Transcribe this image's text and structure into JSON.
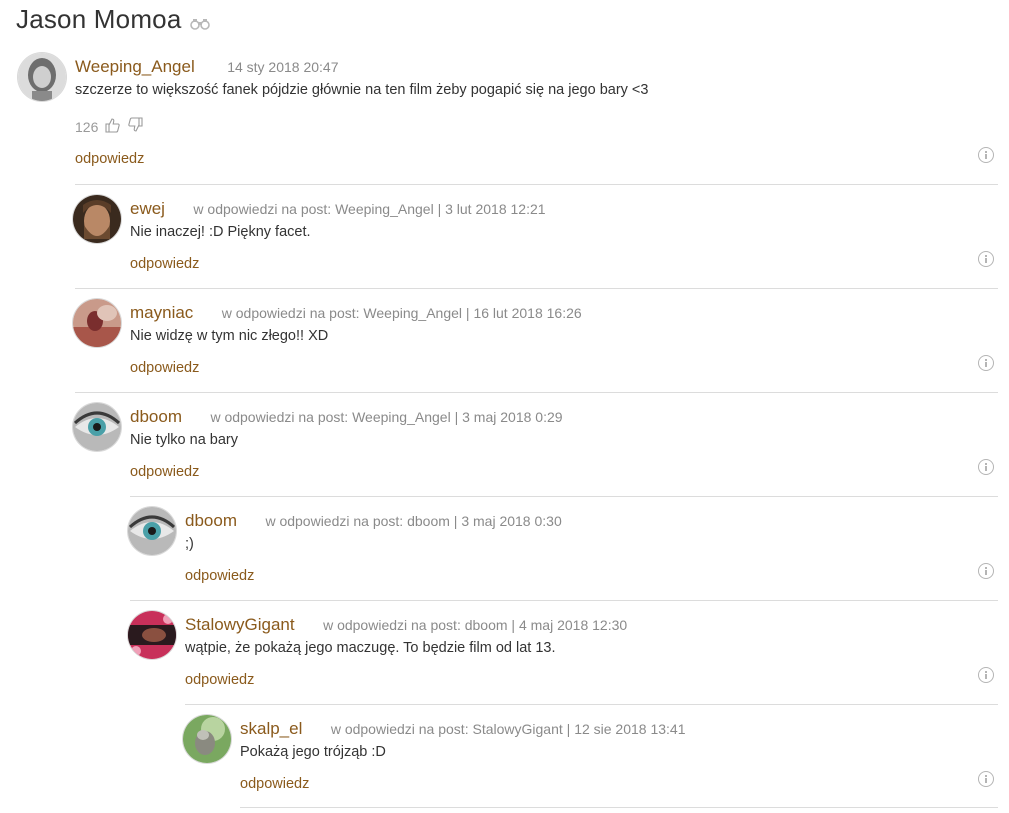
{
  "page": {
    "title": "Jason Momoa",
    "binoculars_icon": "binoculars-icon"
  },
  "colors": {
    "author": "#8a5a1c",
    "meta": "#8a8a8a",
    "divider": "#dcdcdc"
  },
  "reply_prefix": "w odpowiedzi na post:",
  "reply_label": "odpowiedz",
  "comments": [
    {
      "author": "Weeping_Angel",
      "date": "14 sty 2018 20:47",
      "text": "szczerze to większość fanek pójdzie głównie na ten film żeby pogapić się na jego bary <3",
      "likes": "126"
    },
    {
      "author": "ewej",
      "reply_to": "Weeping_Angel",
      "date": "3 lut 2018 12:21",
      "text": "Nie inaczej! :D Piękny facet."
    },
    {
      "author": "mayniac",
      "reply_to": "Weeping_Angel",
      "date": "16 lut 2018 16:26",
      "text": "Nie widzę w tym nic złego!! XD"
    },
    {
      "author": "dboom",
      "reply_to": "Weeping_Angel",
      "date": "3 maj 2018 0:29",
      "text": "Nie tylko na bary"
    },
    {
      "author": "dboom",
      "reply_to": "dboom",
      "date": "3 maj 2018 0:30",
      "text": ";)"
    },
    {
      "author": "StalowyGigant",
      "reply_to": "dboom",
      "date": "4 maj 2018 12:30",
      "text": "wątpie, że pokażą jego maczugę. To będzie film od lat 13."
    },
    {
      "author": "skalp_el",
      "reply_to": "StalowyGigant",
      "date": "12 sie 2018 13:41",
      "text": "Pokażą jego trójząb :D"
    }
  ]
}
